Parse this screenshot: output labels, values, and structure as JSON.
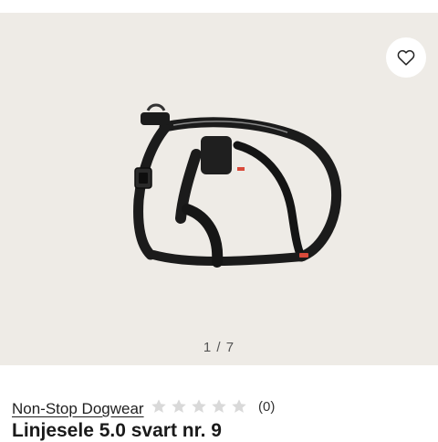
{
  "gallery": {
    "pager": "1 / 7",
    "image_alt": "Linjesele 5.0 svart nr. 9"
  },
  "wishlist": {
    "icon": "heart-outline-icon"
  },
  "product": {
    "brand": "Non-Stop Dogwear",
    "rating": {
      "stars": 0,
      "max_stars": 5,
      "count": "(0)"
    },
    "title": "Linjesele 5.0 svart nr. 9"
  },
  "colors": {
    "gallery_bg": "#eeebe6",
    "star_empty": "#d9d9d9",
    "harness": "#1b1b1b",
    "accent_red": "#d94a3a"
  }
}
